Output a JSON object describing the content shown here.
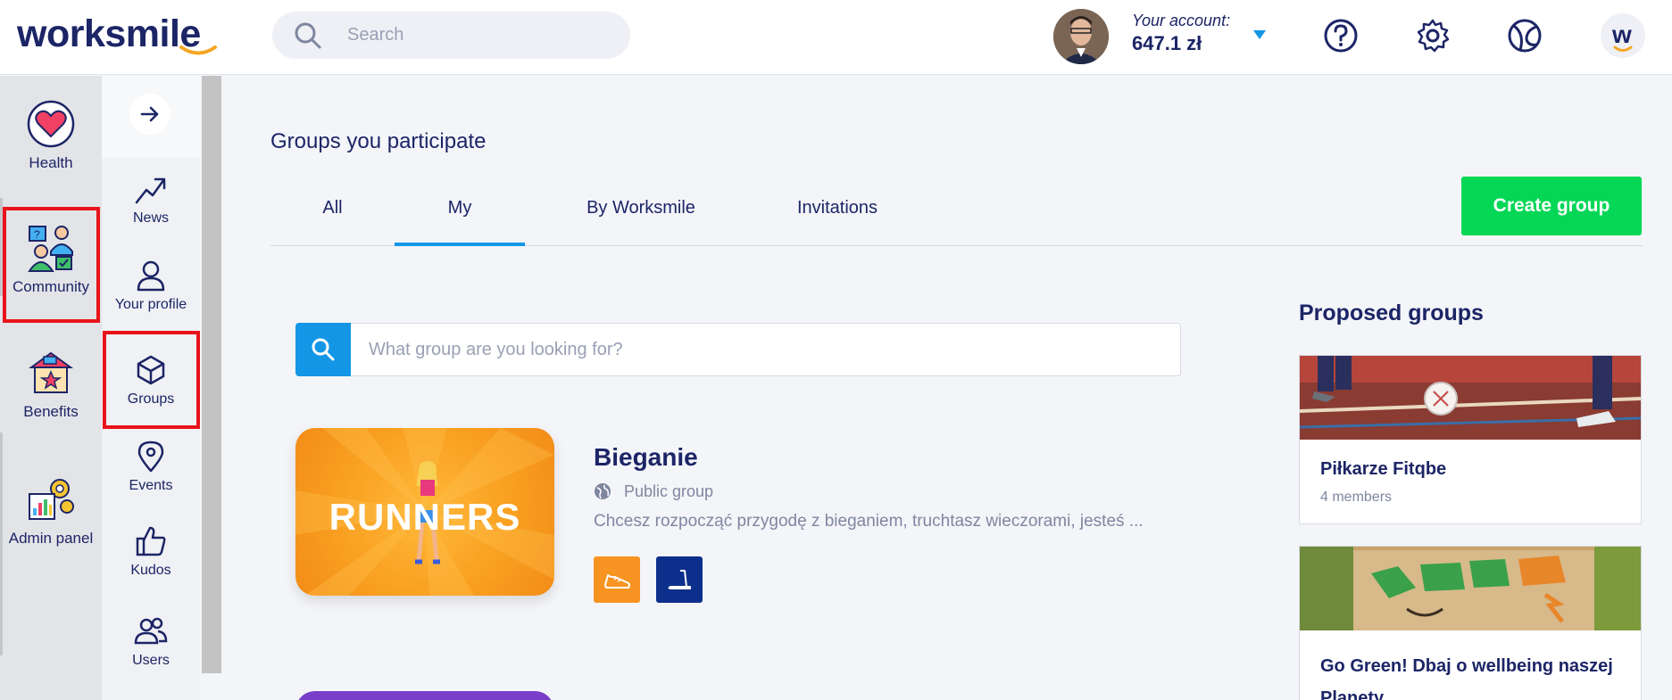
{
  "header": {
    "logo": "worksmile",
    "search_placeholder": "Search",
    "account_label": "Your account:",
    "account_value": "647.1 zł",
    "user_initial": "w"
  },
  "nav_main": {
    "items": [
      {
        "label": "Health",
        "icon": "heart-icon"
      },
      {
        "label": "Community",
        "icon": "community-icon"
      },
      {
        "label": "Benefits",
        "icon": "benefits-icon"
      },
      {
        "label": "Admin panel",
        "icon": "admin-panel-icon"
      }
    ]
  },
  "nav_sub": {
    "items": [
      {
        "label": "News",
        "icon": "trending-icon"
      },
      {
        "label": "Your profile",
        "icon": "profile-icon"
      },
      {
        "label": "Groups",
        "icon": "groups-icon"
      },
      {
        "label": "Events",
        "icon": "location-pin-icon"
      },
      {
        "label": "Kudos",
        "icon": "thumbs-up-icon"
      },
      {
        "label": "Users",
        "icon": "users-icon"
      }
    ]
  },
  "main": {
    "title": "Groups you participate",
    "tabs": [
      {
        "label": "All"
      },
      {
        "label": "My",
        "active": true
      },
      {
        "label": "By Worksmile"
      },
      {
        "label": "Invitations"
      }
    ],
    "create_button": "Create group",
    "group_search_placeholder": "What group are you looking for?",
    "groups": [
      {
        "image_text": "RUNNERS",
        "name": "Bieganie",
        "type": "Public group",
        "description": "Chcesz rozpocząć przygodę z bieganiem, truchtasz wieczorami, jesteś ..."
      }
    ]
  },
  "proposed": {
    "title": "Proposed groups",
    "groups": [
      {
        "name": "Piłkarze Fitqbe",
        "members": "4 members"
      },
      {
        "name": "Go Green! Dbaj o wellbeing naszej Planety",
        "members": ""
      }
    ]
  },
  "colors": {
    "brand_navy": "#1c2566",
    "accent_blue": "#1496e6",
    "create_green": "#04d756",
    "highlight_red": "#e8131b"
  }
}
